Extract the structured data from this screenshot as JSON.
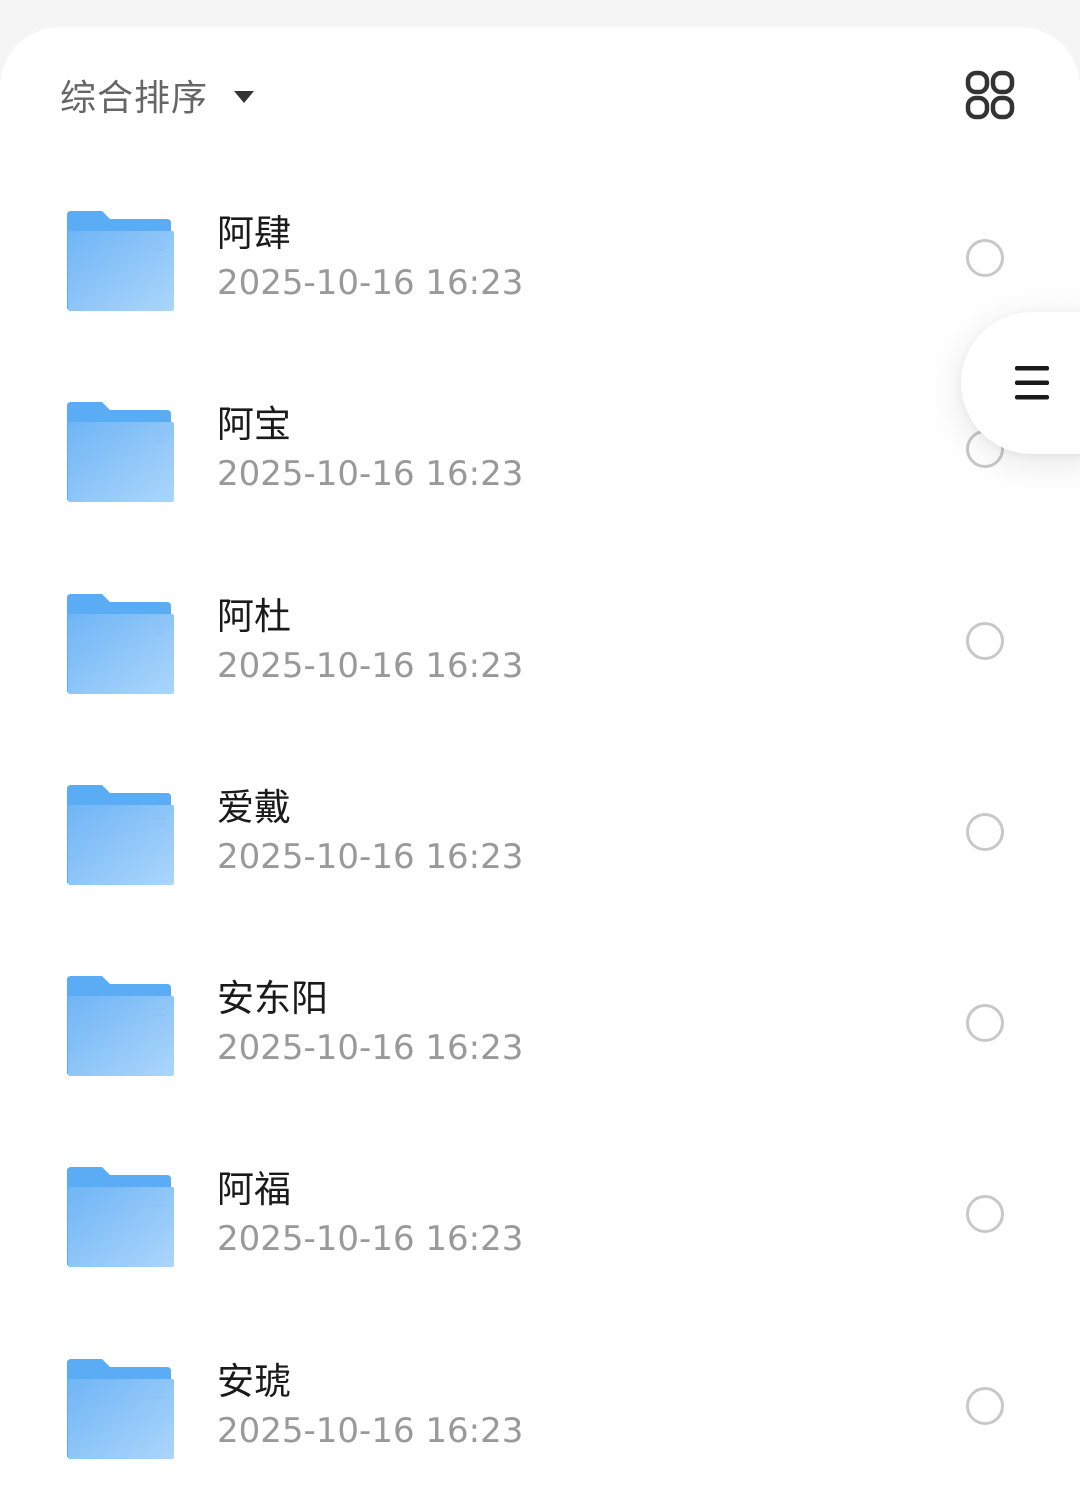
{
  "toolbar": {
    "sort_label": "综合排序",
    "sort_icon": "caret-down-icon",
    "view_toggle_icon": "grid-view-icon"
  },
  "files": [
    {
      "name": "阿肆",
      "date": "2025-10-16 16:23",
      "icon": "folder-icon",
      "selected": false
    },
    {
      "name": "阿宝",
      "date": "2025-10-16 16:23",
      "icon": "folder-icon",
      "selected": false
    },
    {
      "name": "阿杜",
      "date": "2025-10-16 16:23",
      "icon": "folder-icon",
      "selected": false
    },
    {
      "name": "爱戴",
      "date": "2025-10-16 16:23",
      "icon": "folder-icon",
      "selected": false
    },
    {
      "name": "安东阳",
      "date": "2025-10-16 16:23",
      "icon": "folder-icon",
      "selected": false
    },
    {
      "name": "阿福",
      "date": "2025-10-16 16:23",
      "icon": "folder-icon",
      "selected": false
    },
    {
      "name": "安琥",
      "date": "2025-10-16 16:23",
      "icon": "folder-icon",
      "selected": false
    }
  ],
  "floating_menu": {
    "icon": "menu-icon"
  },
  "colors": {
    "folder_back": "#5aacf5",
    "folder_front_top": "#74b8f7",
    "folder_front_bottom": "#a9d4fb",
    "radio_border": "#c8c8c8",
    "name_text": "#1a1a1a",
    "date_text": "#999999"
  }
}
